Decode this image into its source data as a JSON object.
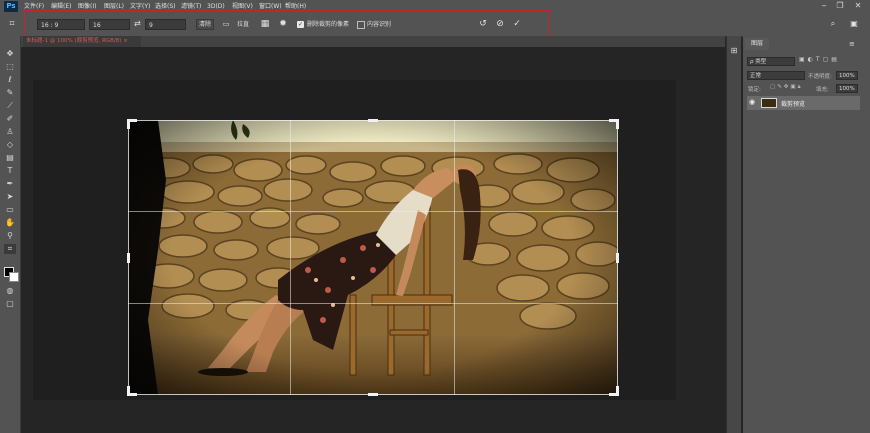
{
  "app": {
    "logo": "Ps"
  },
  "menu": [
    "文件(F)",
    "编辑(E)",
    "图像(I)",
    "图层(L)",
    "文字(Y)",
    "选择(S)",
    "滤镜(T)",
    "3D(D)",
    "视图(V)",
    "窗口(W)",
    "帮助(H)"
  ],
  "window_controls": {
    "minimize": "‒",
    "restore": "❐",
    "close": "✕"
  },
  "options_bar": {
    "ratio": "16 : 9",
    "width": "16",
    "swap": "⇄",
    "height": "9",
    "clear": "清除",
    "straighten": "拉直",
    "overlay_icon": "grid-overlay-icon",
    "settings_icon": "gear-icon",
    "delete_cropped_checked": true,
    "delete_cropped_label": "删除裁剪的像素",
    "content_aware_checked": false,
    "content_aware_label": "内容识别",
    "reset": "↺",
    "cancel": "⊘",
    "commit": "✓",
    "highlight_color": "#c8232c"
  },
  "document": {
    "tab": "未标题-1 @ 100% (裁剪预览, RGB/8) ×"
  },
  "panels": {
    "tab": "图层",
    "kind_search": "ρ 类型",
    "blend_mode": "正常",
    "opacity_label": "不透明度:",
    "opacity": "100%",
    "lock_label": "锁定:",
    "fill_label": "填充:",
    "fill": "100%",
    "layer_name": "裁剪预览"
  }
}
